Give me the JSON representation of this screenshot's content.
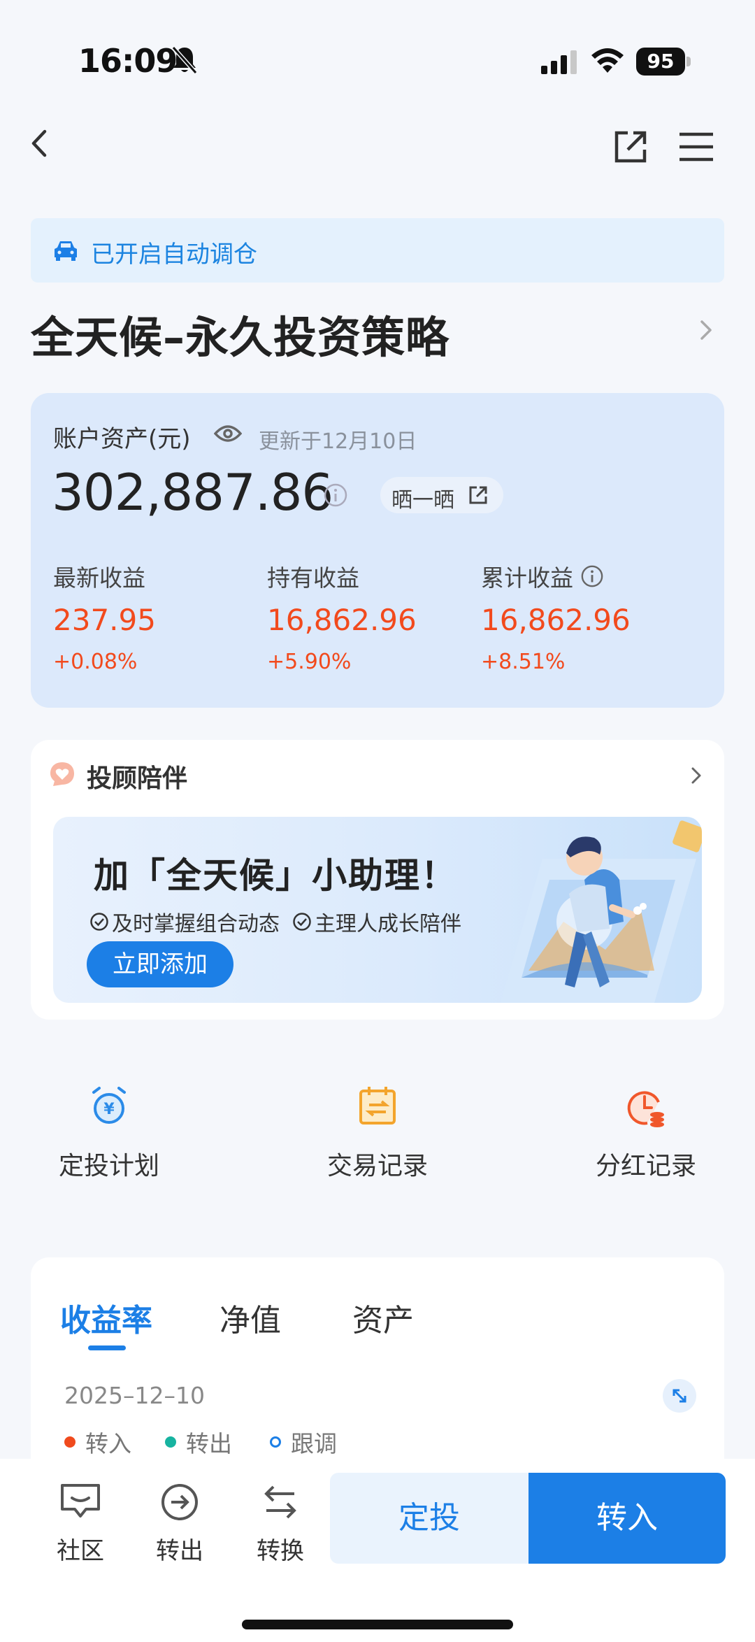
{
  "status": {
    "time": "16:09",
    "battery": "95"
  },
  "banner": {
    "text": "已开启自动调仓"
  },
  "page_title": "全天候–永久投资策略",
  "asset": {
    "label": "账户资产(元)",
    "updated": "更新于12月10日",
    "value": "302,887.86",
    "share_label": "晒一晒",
    "metrics": [
      {
        "label": "最新收益",
        "value": "237.95",
        "pct": "+0.08%"
      },
      {
        "label": "持有收益",
        "value": "16,862.96",
        "pct": "+5.90%"
      },
      {
        "label": "累计收益",
        "value": "16,862.96",
        "pct": "+8.51%"
      }
    ]
  },
  "advisor": {
    "title": "投顾陪伴",
    "promo_title": "加「全天候」小助理！",
    "points": [
      "及时掌握组合动态",
      "主理人成长陪伴"
    ],
    "add_button": "立即添加"
  },
  "quick_actions": [
    {
      "label": "定投计划",
      "icon": "alarm-clock-yen-icon"
    },
    {
      "label": "交易记录",
      "icon": "calendar-transfer-icon"
    },
    {
      "label": "分红记录",
      "icon": "clock-coin-icon"
    }
  ],
  "chart": {
    "tabs": [
      "收益率",
      "净值",
      "资产"
    ],
    "active_tab": "收益率",
    "date": "2025–12–10",
    "legend": [
      {
        "label": "转入",
        "color": "#f04a1d"
      },
      {
        "label": "转出",
        "color": "#17b3a0"
      },
      {
        "label": "跟调",
        "color": "#1c7fe6"
      }
    ]
  },
  "bottom_bar": {
    "items": [
      {
        "label": "社区",
        "icon": "chat-icon"
      },
      {
        "label": "转出",
        "icon": "arrow-circle-icon"
      },
      {
        "label": "转换",
        "icon": "swap-icon"
      }
    ],
    "dingtou": "定投",
    "zhuanru": "转入"
  },
  "colors": {
    "accent": "#1c7fe6",
    "gain": "#f24a1d"
  }
}
